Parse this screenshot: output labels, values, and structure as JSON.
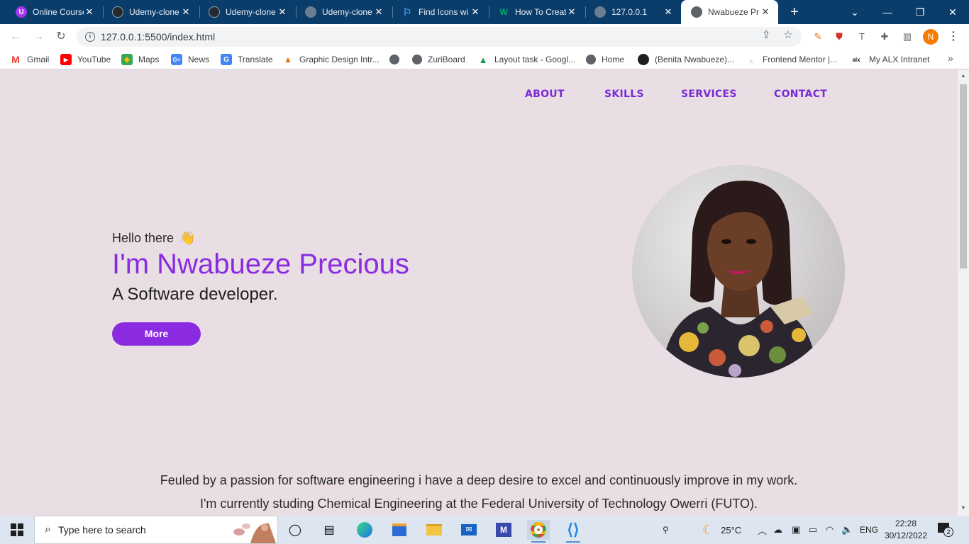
{
  "browser": {
    "tabs": [
      {
        "title": "Online Course",
        "icon": "udemy-icon",
        "color": "#a435f0"
      },
      {
        "title": "Udemy-clone",
        "icon": "github-icon",
        "color": "#24292f"
      },
      {
        "title": "Udemy-clone",
        "icon": "github-icon",
        "color": "#24292f"
      },
      {
        "title": "Udemy-clone",
        "icon": "globe-icon",
        "color": "#5f6368"
      },
      {
        "title": "Find Icons wi",
        "icon": "flag-icon",
        "color": "#1a73e8"
      },
      {
        "title": "How To Creat",
        "icon": "w3-icon",
        "color": "#04aa6d"
      },
      {
        "title": "127.0.0.1",
        "icon": "globe-icon",
        "color": "#5f6368"
      },
      {
        "title": "Nwabueze Pr",
        "icon": "globe-icon",
        "color": "#5f6368",
        "active": true
      }
    ],
    "url": "127.0.0.1:5500/index.html",
    "profile_initial": "N",
    "bookmarks": [
      {
        "label": "Gmail",
        "icon": "gmail-icon"
      },
      {
        "label": "YouTube",
        "icon": "youtube-icon"
      },
      {
        "label": "Maps",
        "icon": "maps-icon"
      },
      {
        "label": "News",
        "icon": "news-icon"
      },
      {
        "label": "Translate",
        "icon": "translate-icon"
      },
      {
        "label": "Graphic Design Intr...",
        "icon": "course-icon"
      },
      {
        "label": "",
        "icon": "globe-icon"
      },
      {
        "label": "ZuriBoard",
        "icon": "globe-icon"
      },
      {
        "label": "Layout task - Googl...",
        "icon": "drive-icon"
      },
      {
        "label": "Home",
        "icon": "globe-icon"
      },
      {
        "label": "(Benita Nwabueze)...",
        "icon": "github-icon"
      },
      {
        "label": "Frontend Mentor |...",
        "icon": "frontend-mentor-icon"
      },
      {
        "label": "My ALX Intranet",
        "icon": "alx-icon"
      }
    ]
  },
  "site": {
    "nav": [
      "ABOUT",
      "SKILLS",
      "SERVICES",
      "CONTACT"
    ],
    "greeting": "Hello there",
    "greeting_emoji": "👋",
    "name": "I'm Nwabueze Precious",
    "role": "A Software developer.",
    "cta": "More",
    "bio": [
      "Feuled by a passion for software engineering i have a deep desire to excel and continuously improve in my work.",
      "I'm currently studing Chemical Engineering at the Federal University of Technology Owerri (FUTO)."
    ],
    "accent_color": "#8a2be2",
    "background_color": "#e9dee4"
  },
  "taskbar": {
    "search_placeholder": "Type here to search",
    "weather": "25°C",
    "language": "ENG",
    "time": "22:28",
    "date": "30/12/2022",
    "notifications": "2"
  }
}
